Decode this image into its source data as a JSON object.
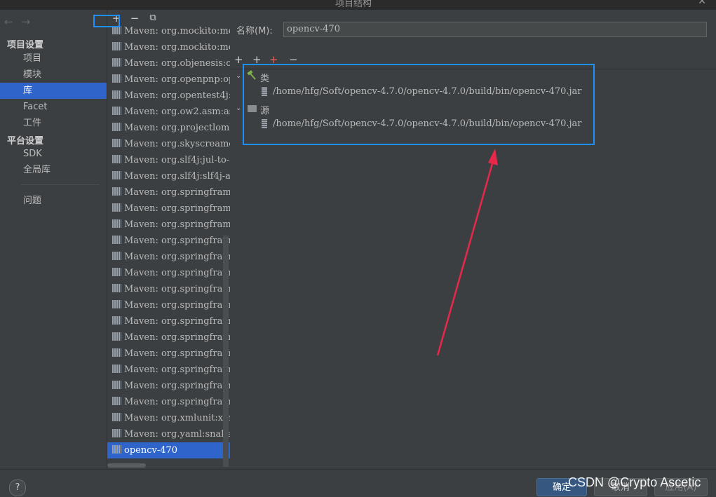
{
  "window": {
    "title": "项目结构",
    "close_label": "✕"
  },
  "nav": {
    "back_label": "←",
    "forward_label": "→",
    "project_settings_header": "项目设置",
    "platform_settings_header": "平台设置",
    "project_items": [
      {
        "label": "项目"
      },
      {
        "label": "模块"
      },
      {
        "label": "库"
      },
      {
        "label": "Facet"
      },
      {
        "label": "工件"
      }
    ],
    "platform_items": [
      {
        "label": "SDK"
      },
      {
        "label": "全局库"
      }
    ],
    "problems_label": "问题",
    "selected": "库"
  },
  "library_toolbar": {
    "add": "+",
    "remove": "−",
    "copy": "⧉"
  },
  "libraries": [
    "Maven: org.mockito:mo",
    "Maven: org.mockito:mo",
    "Maven: org.objenesis:ol",
    "Maven: org.openpnp:op",
    "Maven: org.opentest4j:o",
    "Maven: org.ow2.asm:as",
    "Maven: org.projectloml",
    "Maven: org.skyscreame",
    "Maven: org.slf4j:jul-to-s",
    "Maven: org.slf4j:slf4j-ap",
    "Maven: org.springframe",
    "Maven: org.springframe",
    "Maven: org.springframe",
    "Maven: org.springframe",
    "Maven: org.springframe",
    "Maven: org.springframe",
    "Maven: org.springframe",
    "Maven: org.springframe",
    "Maven: org.springframe",
    "Maven: org.springframe",
    "Maven: org.springframe",
    "Maven: org.springframe",
    "Maven: org.springframe",
    "Maven: org.springframe",
    "Maven: org.xmlunit:xm",
    "Maven: org.yaml:snake",
    "opencv-470"
  ],
  "selected_library": "opencv-470",
  "details": {
    "name_label": "名称(M):",
    "name_value": "opencv-470",
    "toolbar": {
      "add": "+",
      "add_class": "+",
      "add_source": "+",
      "remove": "−"
    },
    "classes_label": "类",
    "classes_path": "/home/hfg/Soft/opencv-4.7.0/opencv-4.7.0/build/bin/opencv-470.jar",
    "sources_label": "源",
    "sources_path": "/home/hfg/Soft/opencv-4.7.0/opencv-4.7.0/build/bin/opencv-470.jar"
  },
  "footer": {
    "help": "?",
    "ok": "确定",
    "cancel": "取消",
    "apply": "应用(A)",
    "watermark": "CSDN @Crypto Ascetic"
  },
  "colors": {
    "selection": "#2f65ca",
    "highlight_box": "#1e8fff",
    "arrow": "#e8284a",
    "background": "#3c3f41"
  }
}
